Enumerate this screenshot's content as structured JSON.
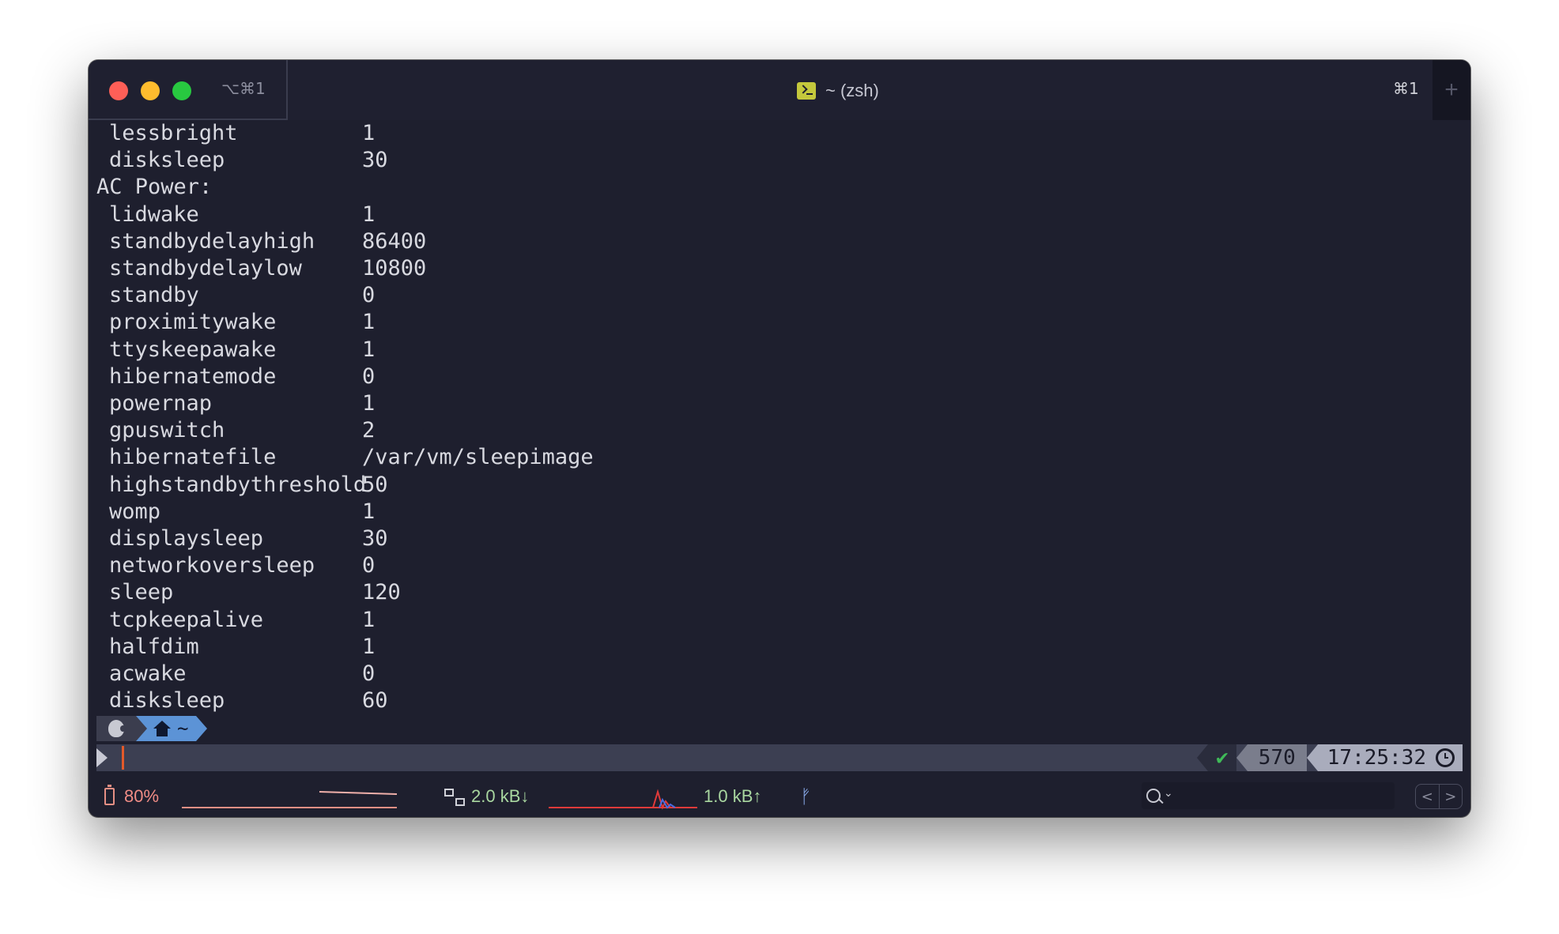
{
  "window": {
    "tab_shortcut": "⌥⌘1",
    "title": "~ (zsh)",
    "right_shortcut": "⌘1",
    "new_tab_label": "+"
  },
  "terminal": {
    "lines": [
      {
        "key": "lessbright",
        "value": "1"
      },
      {
        "key": "disksleep",
        "value": "30"
      },
      {
        "header": "AC Power:"
      },
      {
        "key": "lidwake",
        "value": "1"
      },
      {
        "key": "standbydelayhigh",
        "value": "86400"
      },
      {
        "key": "standbydelaylow",
        "value": "10800"
      },
      {
        "key": "standby",
        "value": "0"
      },
      {
        "key": "proximitywake",
        "value": "1"
      },
      {
        "key": "ttyskeepawake",
        "value": "1"
      },
      {
        "key": "hibernatemode",
        "value": "0"
      },
      {
        "key": "powernap",
        "value": "1"
      },
      {
        "key": "gpuswitch",
        "value": "2"
      },
      {
        "key": "hibernatefile",
        "value": "/var/vm/sleepimage"
      },
      {
        "key": "highstandbythreshold",
        "value": "50"
      },
      {
        "key": "womp",
        "value": "1"
      },
      {
        "key": "displaysleep",
        "value": "30"
      },
      {
        "key": "networkoversleep",
        "value": "0"
      },
      {
        "key": "sleep",
        "value": "120"
      },
      {
        "key": "tcpkeepalive",
        "value": "1"
      },
      {
        "key": "halfdim",
        "value": "1"
      },
      {
        "key": "acwake",
        "value": "0"
      },
      {
        "key": "disksleep",
        "value": "60"
      }
    ]
  },
  "prompt": {
    "dir": "~",
    "status": "✔",
    "history_count": "570",
    "time": "17:25:32"
  },
  "statusbar": {
    "battery": "80%",
    "net_down": "2.0 kB↓",
    "net_up": "1.0 kB↑",
    "git_glyph": "ᚠ"
  },
  "nav": {
    "prev": "<",
    "next": ">"
  },
  "colors": {
    "battery": "#f08c85",
    "network": "#a9d7a0",
    "prompt_dir_bg": "#5c93d6"
  }
}
